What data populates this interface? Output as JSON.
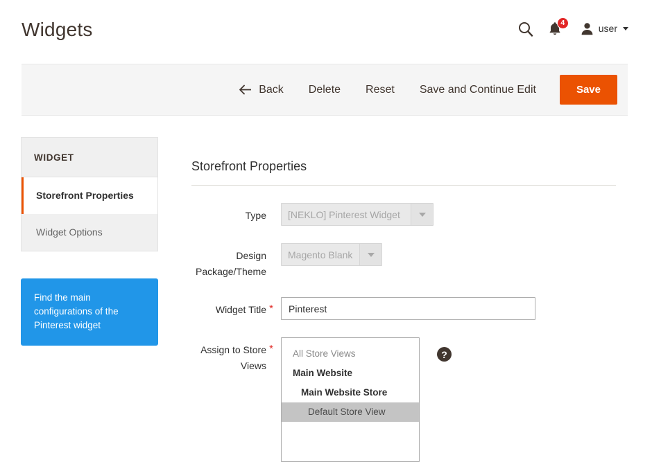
{
  "header": {
    "title": "Widgets",
    "search_icon": "search-icon",
    "notifications": {
      "icon": "bell-icon",
      "count": "4",
      "badge_color": "#e22626"
    },
    "user": {
      "avatar_icon": "user-avatar-icon",
      "label": "user",
      "caret_icon": "chevron-down-icon"
    }
  },
  "toolbar": {
    "back_icon": "arrow-left-icon",
    "back_label": "Back",
    "delete_label": "Delete",
    "reset_label": "Reset",
    "save_continue_label": "Save and Continue Edit",
    "save_label": "Save",
    "save_color": "#eb5202"
  },
  "sidebar": {
    "heading": "WIDGET",
    "items": [
      {
        "label": "Storefront Properties",
        "active": true
      },
      {
        "label": "Widget Options",
        "active": false
      }
    ],
    "accent_color": "#eb5202"
  },
  "hint": {
    "text": "Find the main configurations of the Pinterest widget",
    "background": "#2196e8"
  },
  "main": {
    "section_title": "Storefront Properties",
    "fields": {
      "type": {
        "label": "Type",
        "value": "[NEKLO] Pinterest Widget",
        "disabled": true,
        "required": false,
        "arrow_icon": "chevron-down-icon"
      },
      "theme": {
        "label": "Design Package/Theme",
        "value": "Magento Blank",
        "disabled": true,
        "required": false,
        "arrow_icon": "chevron-down-icon"
      },
      "widget_title": {
        "label": "Widget Title",
        "value": "Pinterest",
        "placeholder": "",
        "required": true,
        "required_marker": "*"
      },
      "store_views": {
        "label": "Assign to Store Views",
        "required": true,
        "required_marker": "*",
        "help_icon": "question-mark-icon",
        "options": [
          {
            "label": "All Store Views",
            "level": "all",
            "selected": false
          },
          {
            "label": "Main Website",
            "level": "website",
            "selected": false
          },
          {
            "label": "Main Website Store",
            "level": "store",
            "selected": false
          },
          {
            "label": "Default Store View",
            "level": "view",
            "selected": true
          }
        ]
      }
    }
  }
}
